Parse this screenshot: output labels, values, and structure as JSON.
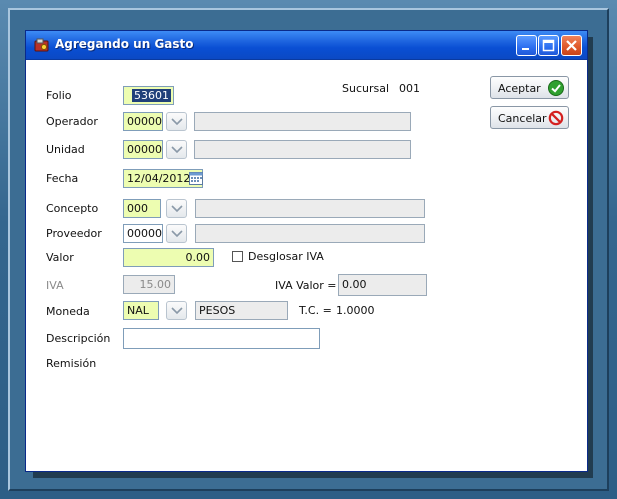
{
  "window": {
    "title": "Agregando un Gasto"
  },
  "header": {
    "sucursal_label": "Sucursal",
    "sucursal_value": "001"
  },
  "buttons": {
    "aceptar": "Aceptar",
    "cancelar": "Cancelar"
  },
  "form": {
    "folio": {
      "label": "Folio",
      "value": "53601"
    },
    "operador": {
      "label": "Operador",
      "code": "00000",
      "description": ""
    },
    "unidad": {
      "label": "Unidad",
      "code": "00000",
      "description": ""
    },
    "fecha": {
      "label": "Fecha",
      "value": "12/04/2012"
    },
    "concepto": {
      "label": "Concepto",
      "code": "000",
      "description": ""
    },
    "proveedor": {
      "label": "Proveedor",
      "code": "00000",
      "description": ""
    },
    "valor": {
      "label": "Valor",
      "value": "0.00"
    },
    "desglosar_iva": {
      "label": "Desglosar IVA",
      "checked": false
    },
    "iva": {
      "label": "IVA",
      "value": "15.00"
    },
    "iva_valor": {
      "label": "IVA Valor =",
      "value": "0.00"
    },
    "moneda": {
      "label": "Moneda",
      "code": "NAL",
      "description": "PESOS"
    },
    "tc": {
      "label": "T.C. =",
      "value": "1.0000"
    },
    "descripcion": {
      "label": "Descripción",
      "value": ""
    },
    "remision": {
      "label": "Remisión"
    }
  },
  "colors": {
    "titlebar": "#0a4fd4",
    "required_field": "#edfdb1",
    "readonly_field": "#ececec",
    "accept_icon": "#2fa02f",
    "cancel_icon": "#d42020"
  },
  "icons": {
    "app": "app-icon",
    "minimize": "minimize-icon",
    "maximize": "maximize-icon",
    "close": "close-icon",
    "dropdown": "chevron-down-icon",
    "calendar": "calendar-icon",
    "accept": "check-icon",
    "cancel": "no-entry-icon"
  }
}
